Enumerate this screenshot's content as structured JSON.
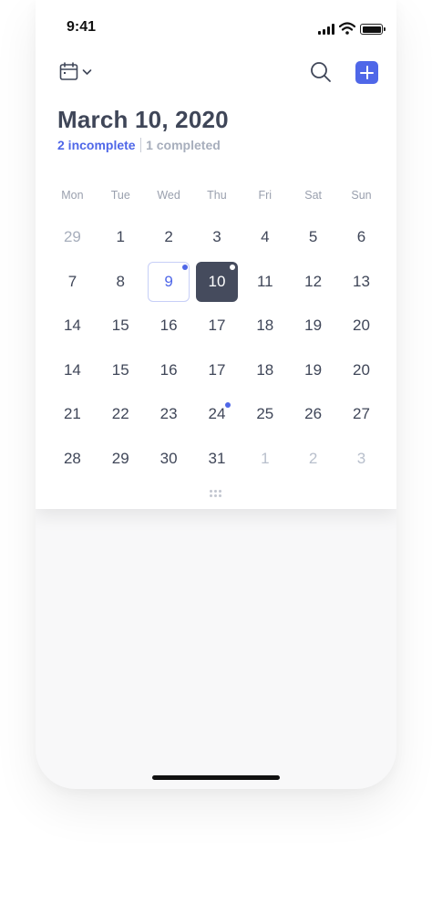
{
  "status_bar": {
    "time": "9:41"
  },
  "header": {
    "calendar_icon": "calendar-icon",
    "chevron_icon": "chevron-down-icon",
    "search_icon": "search-icon",
    "add_icon": "plus-icon",
    "accent_color": "#4f67e8"
  },
  "date_title": "March 10, 2020",
  "summary": {
    "incomplete": "2 incomplete",
    "separator": "|",
    "completed": "1 completed"
  },
  "weekdays": [
    "Mon",
    "Tue",
    "Wed",
    "Thu",
    "Fri",
    "Sat",
    "Sun"
  ],
  "weeks": [
    [
      {
        "d": "29",
        "muted": true
      },
      {
        "d": "1"
      },
      {
        "d": "2"
      },
      {
        "d": "3"
      },
      {
        "d": "4"
      },
      {
        "d": "5"
      },
      {
        "d": "6"
      }
    ],
    [
      {
        "d": "7"
      },
      {
        "d": "8"
      },
      {
        "d": "9",
        "state": "today",
        "dot": "blue"
      },
      {
        "d": "10",
        "state": "selected",
        "dot": "white"
      },
      {
        "d": "11"
      },
      {
        "d": "12"
      },
      {
        "d": "13"
      }
    ],
    [
      {
        "d": "14"
      },
      {
        "d": "15"
      },
      {
        "d": "16"
      },
      {
        "d": "17"
      },
      {
        "d": "18"
      },
      {
        "d": "19"
      },
      {
        "d": "20"
      }
    ],
    [
      {
        "d": "14"
      },
      {
        "d": "15"
      },
      {
        "d": "16"
      },
      {
        "d": "17"
      },
      {
        "d": "18"
      },
      {
        "d": "19"
      },
      {
        "d": "20"
      }
    ],
    [
      {
        "d": "21"
      },
      {
        "d": "22"
      },
      {
        "d": "23"
      },
      {
        "d": "24",
        "dot": "blue"
      },
      {
        "d": "25"
      },
      {
        "d": "26"
      },
      {
        "d": "27"
      }
    ],
    [
      {
        "d": "28"
      },
      {
        "d": "29"
      },
      {
        "d": "30"
      },
      {
        "d": "31"
      },
      {
        "d": "1",
        "muted": true
      },
      {
        "d": "2",
        "muted": true
      },
      {
        "d": "3",
        "muted": true
      }
    ]
  ]
}
